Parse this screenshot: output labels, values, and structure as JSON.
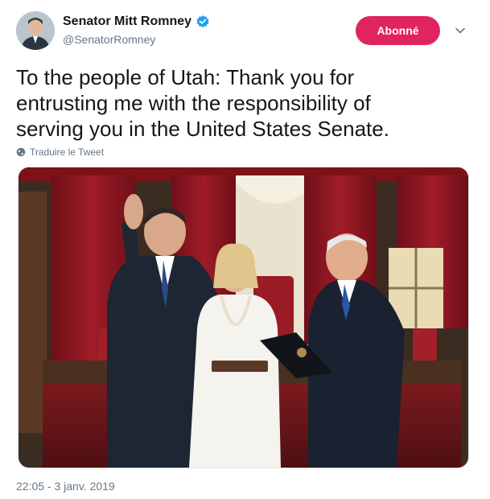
{
  "author": {
    "display_name": "Senator Mitt Romney",
    "handle": "@SenatorRomney",
    "verified": true,
    "avatar_icon": "profile-photo"
  },
  "actions": {
    "follow_label": "Abonné",
    "follow_color": "#e0245e",
    "more_icon": "chevron-down-icon"
  },
  "tweet": {
    "lines": [
      "To the people of Utah: Thank you for",
      "entrusting me with the responsibility of",
      "serving you in the United States Senate."
    ],
    "translate_label": "Traduire le Tweet",
    "timestamp": "22:05 - 3 janv. 2019"
  },
  "colors": {
    "text": "#14171a",
    "secondary": "#657786",
    "verified_blue": "#1da1f2",
    "curtain_red": "#8b1620"
  }
}
